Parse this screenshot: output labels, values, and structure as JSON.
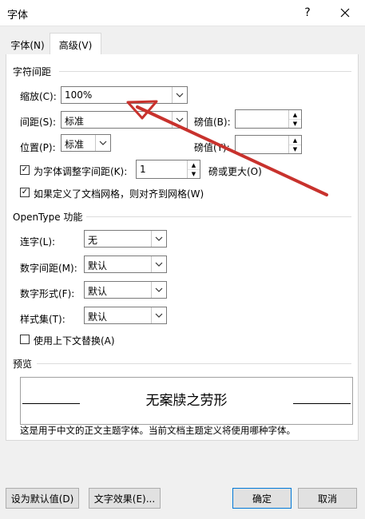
{
  "window": {
    "title": "字体",
    "help_label": "?",
    "close_label": "✕"
  },
  "tabs": [
    {
      "label": "字体(N)",
      "active": false
    },
    {
      "label": "高级(V)",
      "active": true
    }
  ],
  "char_spacing": {
    "heading": "字符间距",
    "scale_label": "缩放(C):",
    "scale_value": "100%",
    "spacing_label": "间距(S):",
    "spacing_value": "标准",
    "spacing_pt_label": "磅值(B):",
    "spacing_pt_value": "",
    "position_label": "位置(P):",
    "position_value": "标准",
    "position_pt_label": "磅值(Y):",
    "position_pt_value": "",
    "kerning_label": "为字体调整字间距(K):",
    "kerning_checked": true,
    "kerning_value": "1",
    "kerning_suffix": "磅或更大(O)",
    "grid_label": "如果定义了文档网格，则对齐到网格(W)",
    "grid_checked": true
  },
  "opentype": {
    "heading": "OpenType 功能",
    "ligature_label": "连字(L):",
    "ligature_value": "无",
    "num_spacing_label": "数字间距(M):",
    "num_spacing_value": "默认",
    "num_form_label": "数字形式(F):",
    "num_form_value": "默认",
    "style_set_label": "样式集(T):",
    "style_set_value": "默认",
    "contextual_label": "使用上下文替换(A)",
    "contextual_checked": false
  },
  "preview": {
    "heading": "预览",
    "sample_text": "无案牍之劳形",
    "description": "这是用于中文的正文主题字体。当前文档主题定义将使用哪种字体。"
  },
  "buttons": {
    "set_default": "设为默认值(D)",
    "text_effects": "文字效果(E)...",
    "ok": "确定",
    "cancel": "取消"
  },
  "colors": {
    "annotation_arrow": "#c8322d",
    "default_button_border": "#0078d7"
  }
}
